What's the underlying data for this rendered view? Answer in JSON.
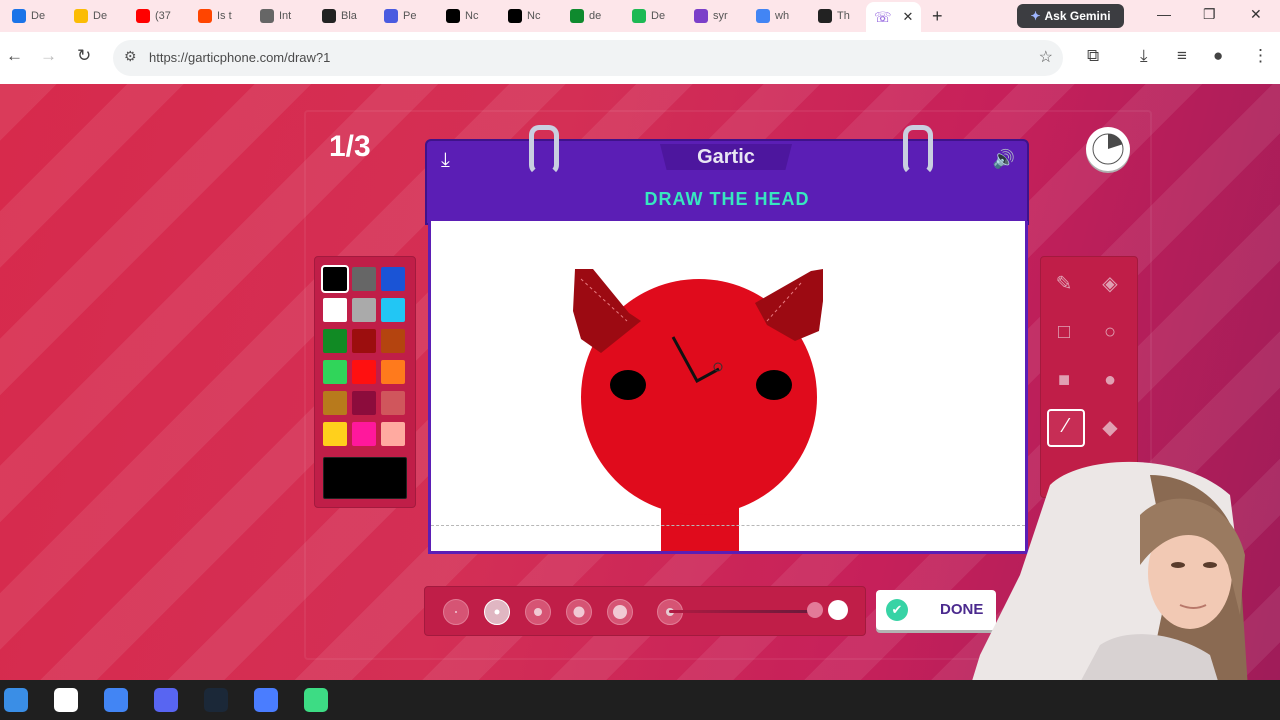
{
  "browser": {
    "tabs": [
      {
        "label": "De",
        "color": "#1a73e8"
      },
      {
        "label": "De",
        "color": "#fbbc04"
      },
      {
        "label": "(37",
        "color": "#ff0000"
      },
      {
        "label": "Is t",
        "color": "#ff4500"
      },
      {
        "label": "Int",
        "color": "#666666"
      },
      {
        "label": "Bla",
        "color": "#222222"
      },
      {
        "label": "Pe",
        "color": "#4a5be0"
      },
      {
        "label": "Nc",
        "color": "#000000"
      },
      {
        "label": "Nc",
        "color": "#000000"
      },
      {
        "label": "de",
        "color": "#0f8a2e"
      },
      {
        "label": "De",
        "color": "#1db954"
      },
      {
        "label": "syr",
        "color": "#7b3fc9"
      },
      {
        "label": "wh",
        "color": "#4285f4"
      },
      {
        "label": "Th",
        "color": "#222222"
      }
    ],
    "active_tab_icon": "phone-icon",
    "ask_gemini": "Ask Gemini",
    "url": "https://garticphone.com/draw?1"
  },
  "game": {
    "round": "1/3",
    "logo": "Gartic",
    "prompt": "DRAW THE HEAD",
    "done_label": "DONE",
    "timer_progress": 0.2,
    "palette": [
      "#000000",
      "#666666",
      "#1a54d6",
      "#ffffff",
      "#aaaaaa",
      "#22c6f4",
      "#118a24",
      "#9c0e0e",
      "#b4440f",
      "#30d55a",
      "#ff1010",
      "#ff7a1c",
      "#b87a1c",
      "#8c0c3c",
      "#d0565c",
      "#ffd01c",
      "#ff189c",
      "#ffaaa0"
    ],
    "selected_color": "#000000",
    "tools": [
      "pencil-icon",
      "eraser-icon",
      "rectangle-outline-icon",
      "ellipse-outline-icon",
      "rectangle-fill-icon",
      "ellipse-fill-icon",
      "line-icon",
      "fill-bucket-icon"
    ],
    "selected_tool": "line-icon",
    "brush_sizes": 5,
    "selected_brush": 2,
    "opacity": 1.0
  },
  "taskbar": {
    "apps": [
      "windows-icon",
      "task-view-icon",
      "chrome-icon",
      "discord-icon",
      "steam-icon",
      "roblox-icon",
      "android-app-icon"
    ]
  }
}
